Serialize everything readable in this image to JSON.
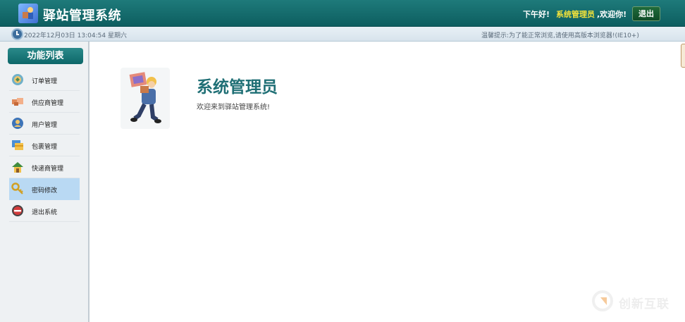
{
  "header": {
    "app_title": "驿站管理系统",
    "greeting_prefix": "下午好!",
    "user_role": "系统管理员",
    "greeting_suffix": ",欢迎你!",
    "logout_label": "退出"
  },
  "status_bar": {
    "datetime": "2022年12月03日 13:04:54 星期六",
    "tip": "温馨提示:为了能正常浏览,请使用高版本浏览器!(IE10+)"
  },
  "sidebar": {
    "title": "功能列表",
    "items": [
      {
        "label": "订单管理",
        "icon": "order-icon",
        "active": false
      },
      {
        "label": "供应商管理",
        "icon": "supplier-icon",
        "active": false
      },
      {
        "label": "用户管理",
        "icon": "user-icon",
        "active": false
      },
      {
        "label": "包裹管理",
        "icon": "package-icon",
        "active": false
      },
      {
        "label": "快递商管理",
        "icon": "home-icon",
        "active": false
      },
      {
        "label": "密码修改",
        "icon": "key-icon",
        "active": true
      },
      {
        "label": "退出系统",
        "icon": "exit-icon",
        "active": false
      }
    ]
  },
  "main": {
    "admin_name": "系统管理员",
    "welcome": "欢迎来到驿站管理系统!"
  },
  "watermark": {
    "text": "创新互联"
  },
  "colors": {
    "header_bg": "#0d5e60",
    "accent_yellow": "#f5e33a",
    "active_item_bg": "#b9d9f3",
    "title_teal": "#1f6f75"
  }
}
